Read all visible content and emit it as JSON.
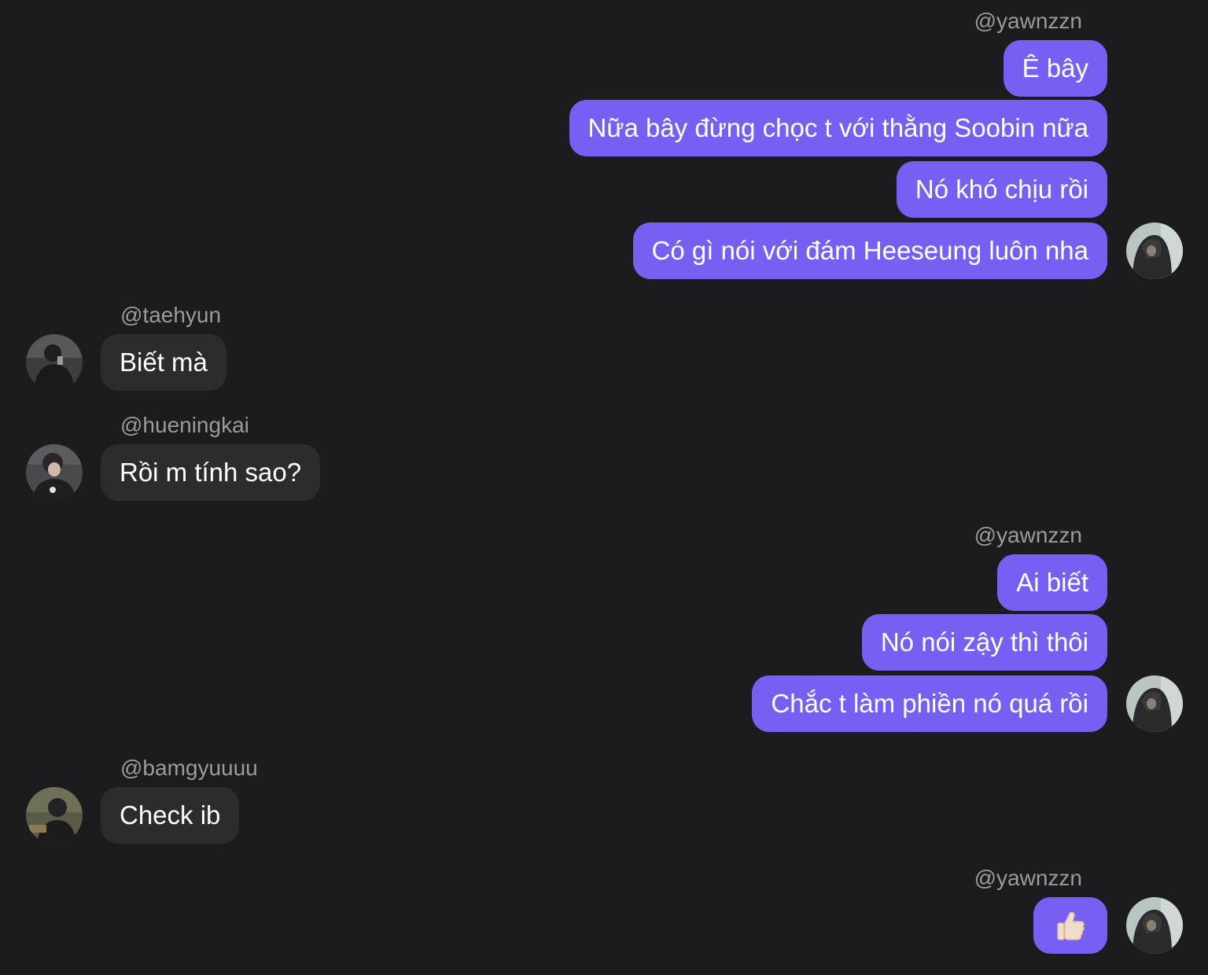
{
  "groups": [
    {
      "username": "@yawnzzn",
      "messages": [
        "Ê bây",
        "Nữa bây đừng chọc t với thằng Soobin nữa",
        "Nó khó chịu rồi",
        "Có gì nói với đám Heeseung luôn nha"
      ]
    },
    {
      "username": "@taehyun",
      "messages": [
        "Biết mà"
      ]
    },
    {
      "username": "@hueningkai",
      "messages": [
        "Rồi m tính sao?"
      ]
    },
    {
      "username": "@yawnzzn",
      "messages": [
        "Ai biết",
        "Nó nói zậy thì thôi",
        "Chắc t làm phiền nó quá rồi"
      ]
    },
    {
      "username": "@bamgyuuuu",
      "messages": [
        "Check ib"
      ]
    },
    {
      "username": "@yawnzzn",
      "messages": [
        "👍🏻"
      ]
    }
  ],
  "colors": {
    "background": "#1c1c1e",
    "outgoing_bubble": "#7660f4",
    "incoming_bubble": "#2c2c2e",
    "username": "#9a9aa0"
  }
}
